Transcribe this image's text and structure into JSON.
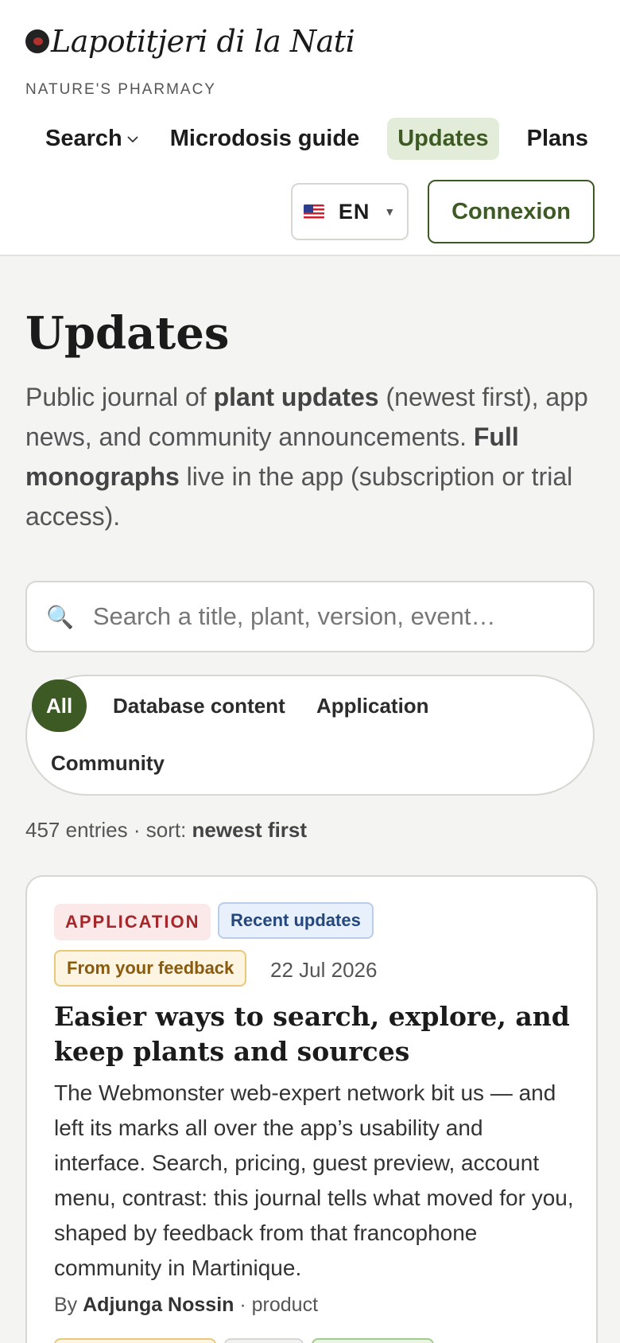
{
  "brand": {
    "name": "Lapotitjeri di la Nati",
    "tagline": "NATURE'S PHARMACY"
  },
  "nav": {
    "items": [
      {
        "label": "Search"
      },
      {
        "label": "Microdosis guide"
      },
      {
        "label": "Updates"
      },
      {
        "label": "Plans"
      }
    ],
    "active": "Updates"
  },
  "lang": {
    "code": "EN",
    "flag": "us-flag-icon"
  },
  "login": {
    "label": "Connexion"
  },
  "page": {
    "title": "Updates",
    "intro": {
      "p1": "Public journal of ",
      "b1": "plant updates",
      "p2": " (newest first), app news, and community announcements. ",
      "b2": "Full monographs",
      "p3": " live in the app (subscription or trial access)."
    }
  },
  "search": {
    "placeholder": "Search a title, plant, version, event…",
    "value": ""
  },
  "filters": [
    {
      "label": "All",
      "active": true
    },
    {
      "label": "Database content",
      "active": false
    },
    {
      "label": "Application",
      "active": false
    },
    {
      "label": "Community",
      "active": false
    }
  ],
  "results": {
    "count_text": "457 entries · sort: ",
    "sort_value": "newest first"
  },
  "entries": [
    {
      "badges": [
        "APPLICATION",
        "Recent updates",
        "From your feedback"
      ],
      "date": "22 Jul 2026",
      "title": "Easier ways to search, explore, and keep plants and sources",
      "body": "The Webmonster web-expert network bit us — and left its marks all over the app’s usability and interface. Search, pricing, guest preview, account menu, contrast: this journal tells what moved for you, shaped by feedback from that francophone community in Martinique.",
      "byline_prefix": "By ",
      "author": "Adjunga Nossin",
      "byline_suffix": " · product"
    }
  ],
  "colors": {
    "accent": "#3d5a24",
    "accent_soft": "#e3ecd8",
    "background": "#f4f4f2"
  }
}
